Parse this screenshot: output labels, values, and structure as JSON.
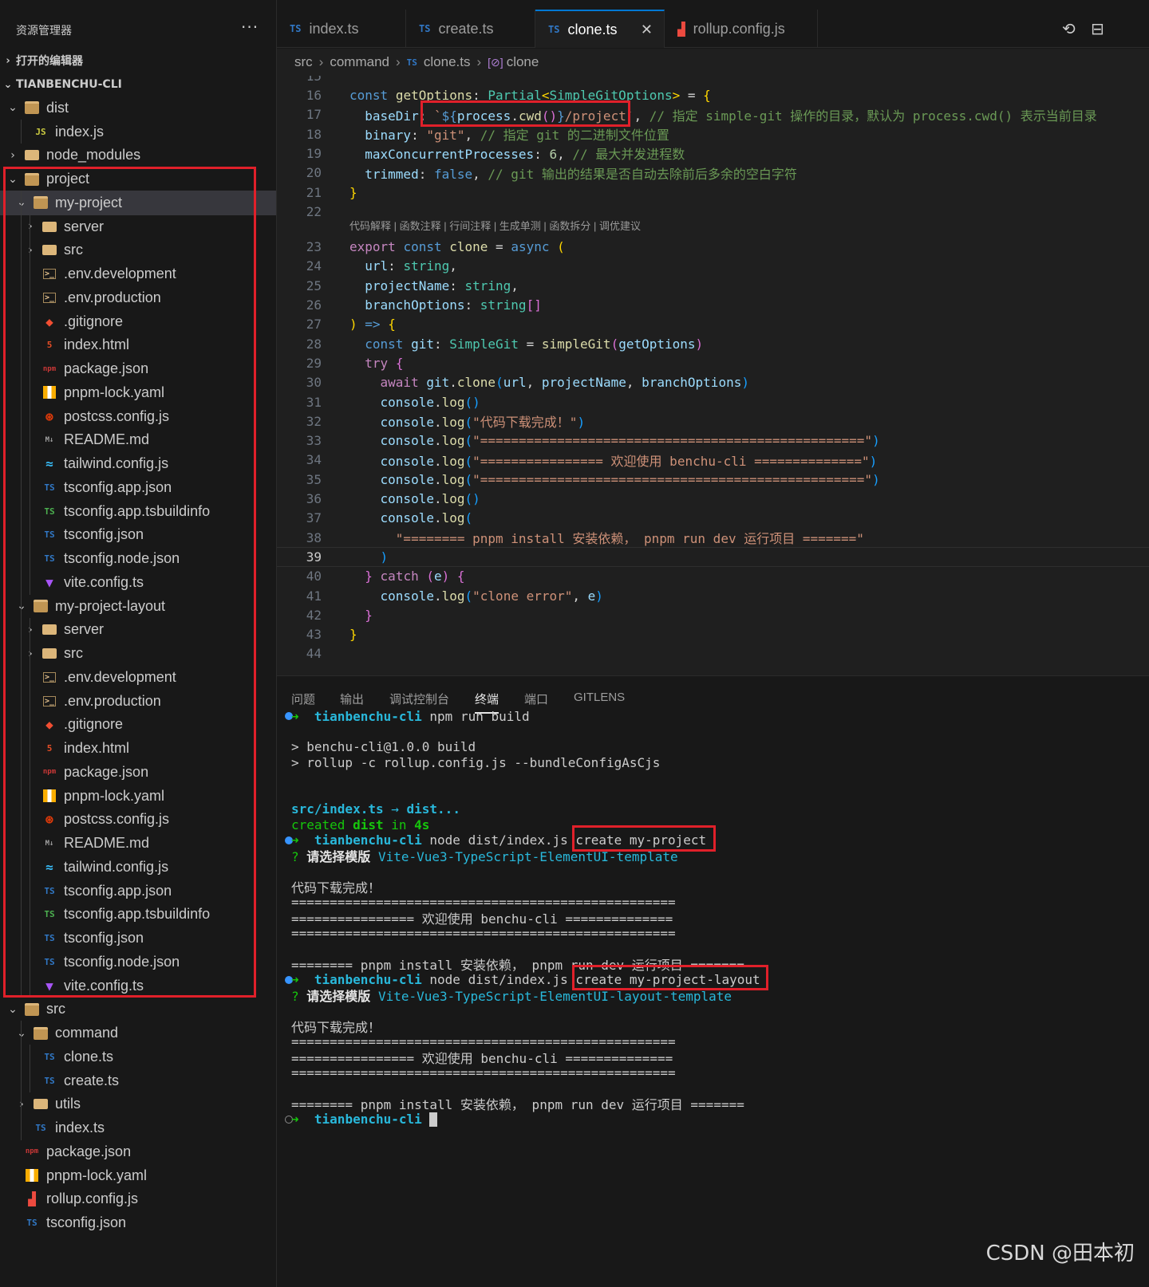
{
  "explorer": {
    "title": "资源管理器",
    "more": "···",
    "open_editors": "打开的编辑器",
    "root": "TIANBENCHU-CLI",
    "tree": [
      {
        "name": "dist",
        "depth": 1,
        "twisty": "⌄",
        "icon": "folder-open"
      },
      {
        "name": "index.js",
        "depth": 2,
        "twisty": "",
        "icon": "js"
      },
      {
        "name": "node_modules",
        "depth": 1,
        "twisty": "›",
        "icon": "folder"
      },
      {
        "name": "project",
        "depth": 1,
        "twisty": "⌄",
        "icon": "folder-open"
      },
      {
        "name": "my-project",
        "depth": 2,
        "twisty": "⌄",
        "icon": "folder-open",
        "selected": true
      },
      {
        "name": "server",
        "depth": 3,
        "twisty": "›",
        "icon": "folder"
      },
      {
        "name": "src",
        "depth": 3,
        "twisty": "›",
        "icon": "folder"
      },
      {
        "name": ".env.development",
        "depth": 3,
        "twisty": "",
        "icon": "env"
      },
      {
        "name": ".env.production",
        "depth": 3,
        "twisty": "",
        "icon": "env"
      },
      {
        "name": ".gitignore",
        "depth": 3,
        "twisty": "",
        "icon": "git"
      },
      {
        "name": "index.html",
        "depth": 3,
        "twisty": "",
        "icon": "html"
      },
      {
        "name": "package.json",
        "depth": 3,
        "twisty": "",
        "icon": "npm"
      },
      {
        "name": "pnpm-lock.yaml",
        "depth": 3,
        "twisty": "",
        "icon": "yaml"
      },
      {
        "name": "postcss.config.js",
        "depth": 3,
        "twisty": "",
        "icon": "postcss"
      },
      {
        "name": "README.md",
        "depth": 3,
        "twisty": "",
        "icon": "md"
      },
      {
        "name": "tailwind.config.js",
        "depth": 3,
        "twisty": "",
        "icon": "tailwind"
      },
      {
        "name": "tsconfig.app.json",
        "depth": 3,
        "twisty": "",
        "icon": "ts"
      },
      {
        "name": "tsconfig.app.tsbuildinfo",
        "depth": 3,
        "twisty": "",
        "icon": "ts-green"
      },
      {
        "name": "tsconfig.json",
        "depth": 3,
        "twisty": "",
        "icon": "ts"
      },
      {
        "name": "tsconfig.node.json",
        "depth": 3,
        "twisty": "",
        "icon": "ts"
      },
      {
        "name": "vite.config.ts",
        "depth": 3,
        "twisty": "",
        "icon": "vite"
      },
      {
        "name": "my-project-layout",
        "depth": 2,
        "twisty": "⌄",
        "icon": "folder-open"
      },
      {
        "name": "server",
        "depth": 3,
        "twisty": "›",
        "icon": "folder"
      },
      {
        "name": "src",
        "depth": 3,
        "twisty": "›",
        "icon": "folder"
      },
      {
        "name": ".env.development",
        "depth": 3,
        "twisty": "",
        "icon": "env"
      },
      {
        "name": ".env.production",
        "depth": 3,
        "twisty": "",
        "icon": "env"
      },
      {
        "name": ".gitignore",
        "depth": 3,
        "twisty": "",
        "icon": "git"
      },
      {
        "name": "index.html",
        "depth": 3,
        "twisty": "",
        "icon": "html"
      },
      {
        "name": "package.json",
        "depth": 3,
        "twisty": "",
        "icon": "npm"
      },
      {
        "name": "pnpm-lock.yaml",
        "depth": 3,
        "twisty": "",
        "icon": "yaml"
      },
      {
        "name": "postcss.config.js",
        "depth": 3,
        "twisty": "",
        "icon": "postcss"
      },
      {
        "name": "README.md",
        "depth": 3,
        "twisty": "",
        "icon": "md"
      },
      {
        "name": "tailwind.config.js",
        "depth": 3,
        "twisty": "",
        "icon": "tailwind"
      },
      {
        "name": "tsconfig.app.json",
        "depth": 3,
        "twisty": "",
        "icon": "ts"
      },
      {
        "name": "tsconfig.app.tsbuildinfo",
        "depth": 3,
        "twisty": "",
        "icon": "ts-green"
      },
      {
        "name": "tsconfig.json",
        "depth": 3,
        "twisty": "",
        "icon": "ts"
      },
      {
        "name": "tsconfig.node.json",
        "depth": 3,
        "twisty": "",
        "icon": "ts"
      },
      {
        "name": "vite.config.ts",
        "depth": 3,
        "twisty": "",
        "icon": "vite"
      },
      {
        "name": "src",
        "depth": 1,
        "twisty": "⌄",
        "icon": "folder-open"
      },
      {
        "name": "command",
        "depth": 2,
        "twisty": "⌄",
        "icon": "folder-open"
      },
      {
        "name": "clone.ts",
        "depth": 3,
        "twisty": "",
        "icon": "ts"
      },
      {
        "name": "create.ts",
        "depth": 3,
        "twisty": "",
        "icon": "ts"
      },
      {
        "name": "utils",
        "depth": 2,
        "twisty": "›",
        "icon": "folder"
      },
      {
        "name": "index.ts",
        "depth": 2,
        "twisty": "",
        "icon": "ts"
      },
      {
        "name": "package.json",
        "depth": 1,
        "twisty": "",
        "icon": "npm"
      },
      {
        "name": "pnpm-lock.yaml",
        "depth": 1,
        "twisty": "",
        "icon": "yaml"
      },
      {
        "name": "rollup.config.js",
        "depth": 1,
        "twisty": "",
        "icon": "rollup"
      },
      {
        "name": "tsconfig.json",
        "depth": 1,
        "twisty": "",
        "icon": "ts"
      }
    ]
  },
  "tabs": [
    {
      "label": "index.ts",
      "icon": "TS"
    },
    {
      "label": "create.ts",
      "icon": "TS"
    },
    {
      "label": "clone.ts",
      "icon": "TS",
      "active": true
    },
    {
      "label": "rollup.config.js",
      "icon": "rollup"
    }
  ],
  "tab_close": "✕",
  "tab_actions": {
    "history": "⟲",
    "split": "⊟"
  },
  "breadcrumb": {
    "parts": [
      "src",
      "command"
    ],
    "file": "clone.ts",
    "file_icon": "TS",
    "symbol": "clone",
    "symbol_icon": "[⊘]",
    "separator": "›"
  },
  "code": {
    "codelens": "代码解释 | 函数注释 | 行间注释 | 生成单测 | 函数拆分 | 调优建议",
    "current_line": 39,
    "lines": [
      {
        "n": "15",
        "html": ""
      },
      {
        "n": "16",
        "html": "<span class='k'>const</span> <span class='f'>getOptions</span><span class='p'>: </span><span class='t'>Partial</span><span class='b1'>&lt;</span><span class='t'>SimpleGitOptions</span><span class='b1'>&gt;</span><span class='p'> = </span><span class='b1'>{</span>"
      },
      {
        "n": "17",
        "html": "  <span class='v'>baseDir</span><span class='p'>: </span><span class='s'>`</span><span class='k'>${</span><span class='v'>process</span><span class='p'>.</span><span class='f'>cwd</span><span class='b2'>()</span><span class='k'>}</span><span class='s'>/project`</span><span class='p'>, </span><span class='c'>// 指定 simple-git 操作的目录，默认为 process.cwd() 表示当前目录</span>"
      },
      {
        "n": "18",
        "html": "  <span class='v'>binary</span><span class='p'>: </span><span class='s'>\"git\"</span><span class='p'>, </span><span class='c'>// 指定 git 的二进制文件位置</span>"
      },
      {
        "n": "19",
        "html": "  <span class='v'>maxConcurrentProcesses</span><span class='p'>: </span><span class='n'>6</span><span class='p'>, </span><span class='c'>// 最大并发进程数</span>"
      },
      {
        "n": "20",
        "html": "  <span class='v'>trimmed</span><span class='p'>: </span><span class='k'>false</span><span class='p'>, </span><span class='c'>// git 输出的结果是否自动去除前后多余的空白字符</span>"
      },
      {
        "n": "21",
        "html": "<span class='b1'>}</span>"
      },
      {
        "n": "22",
        "html": ""
      },
      {
        "n": "23",
        "html": "<span class='kc'>export</span> <span class='k'>const</span> <span class='f'>clone</span><span class='p'> = </span><span class='k'>async</span> <span class='b1'>(</span>"
      },
      {
        "n": "24",
        "html": "  <span class='v'>url</span><span class='p'>: </span><span class='t'>string</span><span class='p'>,</span>"
      },
      {
        "n": "25",
        "html": "  <span class='v'>projectName</span><span class='p'>: </span><span class='t'>string</span><span class='p'>,</span>"
      },
      {
        "n": "26",
        "html": "  <span class='v'>branchOptions</span><span class='p'>: </span><span class='t'>string</span><span class='b2'>[]</span>"
      },
      {
        "n": "27",
        "html": "<span class='b1'>)</span><span class='p'> </span><span class='k'>=&gt;</span> <span class='b1'>{</span>"
      },
      {
        "n": "28",
        "html": "  <span class='k'>const</span> <span class='v'>git</span><span class='p'>: </span><span class='t'>SimpleGit</span><span class='p'> = </span><span class='f'>simpleGit</span><span class='b2'>(</span><span class='v'>getOptions</span><span class='b2'>)</span>"
      },
      {
        "n": "29",
        "html": "  <span class='kc'>try</span> <span class='b2'>{</span>"
      },
      {
        "n": "30",
        "html": "    <span class='kc'>await</span> <span class='v'>git</span><span class='p'>.</span><span class='f'>clone</span><span class='b3'>(</span><span class='v'>url</span><span class='p'>, </span><span class='v'>projectName</span><span class='p'>, </span><span class='v'>branchOptions</span><span class='b3'>)</span>"
      },
      {
        "n": "31",
        "html": "    <span class='v'>console</span><span class='p'>.</span><span class='f'>log</span><span class='b3'>()</span>"
      },
      {
        "n": "32",
        "html": "    <span class='v'>console</span><span class='p'>.</span><span class='f'>log</span><span class='b3'>(</span><span class='s'>\"代码下载完成！\"</span><span class='b3'>)</span>"
      },
      {
        "n": "33",
        "html": "    <span class='v'>console</span><span class='p'>.</span><span class='f'>log</span><span class='b3'>(</span><span class='s'>\"==================================================\"</span><span class='b3'>)</span>"
      },
      {
        "n": "34",
        "html": "    <span class='v'>console</span><span class='p'>.</span><span class='f'>log</span><span class='b3'>(</span><span class='s'>\"================ 欢迎使用 benchu-cli ==============\"</span><span class='b3'>)</span>"
      },
      {
        "n": "35",
        "html": "    <span class='v'>console</span><span class='p'>.</span><span class='f'>log</span><span class='b3'>(</span><span class='s'>\"==================================================\"</span><span class='b3'>)</span>"
      },
      {
        "n": "36",
        "html": "    <span class='v'>console</span><span class='p'>.</span><span class='f'>log</span><span class='b3'>()</span>"
      },
      {
        "n": "37",
        "html": "    <span class='v'>console</span><span class='p'>.</span><span class='f'>log</span><span class='b3'>(</span>"
      },
      {
        "n": "38",
        "html": "      <span class='s'>\"======== pnpm install 安装依赖， pnpm run dev 运行项目 =======\"</span>"
      },
      {
        "n": "39",
        "html": "    <span class='b3'>)</span>"
      },
      {
        "n": "40",
        "html": "  <span class='b2'>}</span> <span class='kc'>catch</span> <span class='b2'>(</span><span class='v'>e</span><span class='b2'>)</span> <span class='b2'>{</span>"
      },
      {
        "n": "41",
        "html": "    <span class='v'>console</span><span class='p'>.</span><span class='f'>log</span><span class='b3'>(</span><span class='s'>\"clone error\"</span><span class='p'>, </span><span class='v'>e</span><span class='b3'>)</span>"
      },
      {
        "n": "42",
        "html": "  <span class='b2'>}</span>"
      },
      {
        "n": "43",
        "html": "<span class='b1'>}</span>"
      },
      {
        "n": "44",
        "html": ""
      }
    ]
  },
  "panel": {
    "tabs": [
      "问题",
      "输出",
      "调试控制台",
      "终端",
      "端口",
      "GITLENS"
    ],
    "active_tab": "终端",
    "terminal": [
      {
        "dot": "blue",
        "html": "<span class='tg'>➜</span>  <span class='tcy'>tianbenchu-cli</span> <span class='tw2'>npm run build</span>"
      },
      {
        "dot": "",
        "html": ""
      },
      {
        "dot": "",
        "html": "<span class='tw2'>&gt; benchu-cli@1.0.0 build</span>"
      },
      {
        "dot": "",
        "html": "<span class='tw2'>&gt; rollup -c rollup.config.js --bundleConfigAsCjs</span>"
      },
      {
        "dot": "",
        "html": ""
      },
      {
        "dot": "",
        "html": ""
      },
      {
        "dot": "",
        "html": "<span class='tcy'>src/index.ts</span> <span class='tcyn'>→</span> <span class='tcy'>dist...</span>"
      },
      {
        "dot": "",
        "html": "<span class='tgn'>created </span><span class='tgb'>dist</span><span class='tgn'> in </span><span class='tgb'>4s</span>"
      },
      {
        "dot": "blue",
        "html": "<span class='tg'>➜</span>  <span class='tcy'>tianbenchu-cli</span> <span class='tw2'>node dist/index.js create my-project</span>"
      },
      {
        "dot": "",
        "html": "<span class='tgn'>?</span> <span class='tb'>请选择模版</span> <span class='tcyn'>Vite-Vue3-TypeScript-ElementUI-template</span>"
      },
      {
        "dot": "",
        "html": ""
      },
      {
        "dot": "",
        "html": "<span class='tw2'>代码下载完成！</span>"
      },
      {
        "dot": "",
        "html": "<span class='tw2'>==================================================</span>"
      },
      {
        "dot": "",
        "html": "<span class='tw2'>================ 欢迎使用 benchu-cli ==============</span>"
      },
      {
        "dot": "",
        "html": "<span class='tw2'>==================================================</span>"
      },
      {
        "dot": "",
        "html": ""
      },
      {
        "dot": "",
        "html": "<span class='tw2'>======== pnpm install 安装依赖， pnpm run dev 运行项目 =======</span>"
      },
      {
        "dot": "blue",
        "html": "<span class='tg'>➜</span>  <span class='tcy'>tianbenchu-cli</span> <span class='tw2'>node dist/index.js create my-project-layout</span>"
      },
      {
        "dot": "",
        "html": "<span class='tgn'>?</span> <span class='tb'>请选择模版</span> <span class='tcyn'>Vite-Vue3-TypeScript-ElementUI-layout-template</span>"
      },
      {
        "dot": "",
        "html": ""
      },
      {
        "dot": "",
        "html": "<span class='tw2'>代码下载完成！</span>"
      },
      {
        "dot": "",
        "html": "<span class='tw2'>==================================================</span>"
      },
      {
        "dot": "",
        "html": "<span class='tw2'>================ 欢迎使用 benchu-cli ==============</span>"
      },
      {
        "dot": "",
        "html": "<span class='tw2'>==================================================</span>"
      },
      {
        "dot": "",
        "html": ""
      },
      {
        "dot": "",
        "html": "<span class='tw2'>======== pnpm install 安装依赖， pnpm run dev 运行项目 =======</span>"
      },
      {
        "dot": "hollow",
        "html": "<span class='tg'>➜</span>  <span class='tcy'>tianbenchu-cli</span> <span class='cursor'></span>"
      }
    ]
  },
  "watermark": "CSDN @田本初"
}
